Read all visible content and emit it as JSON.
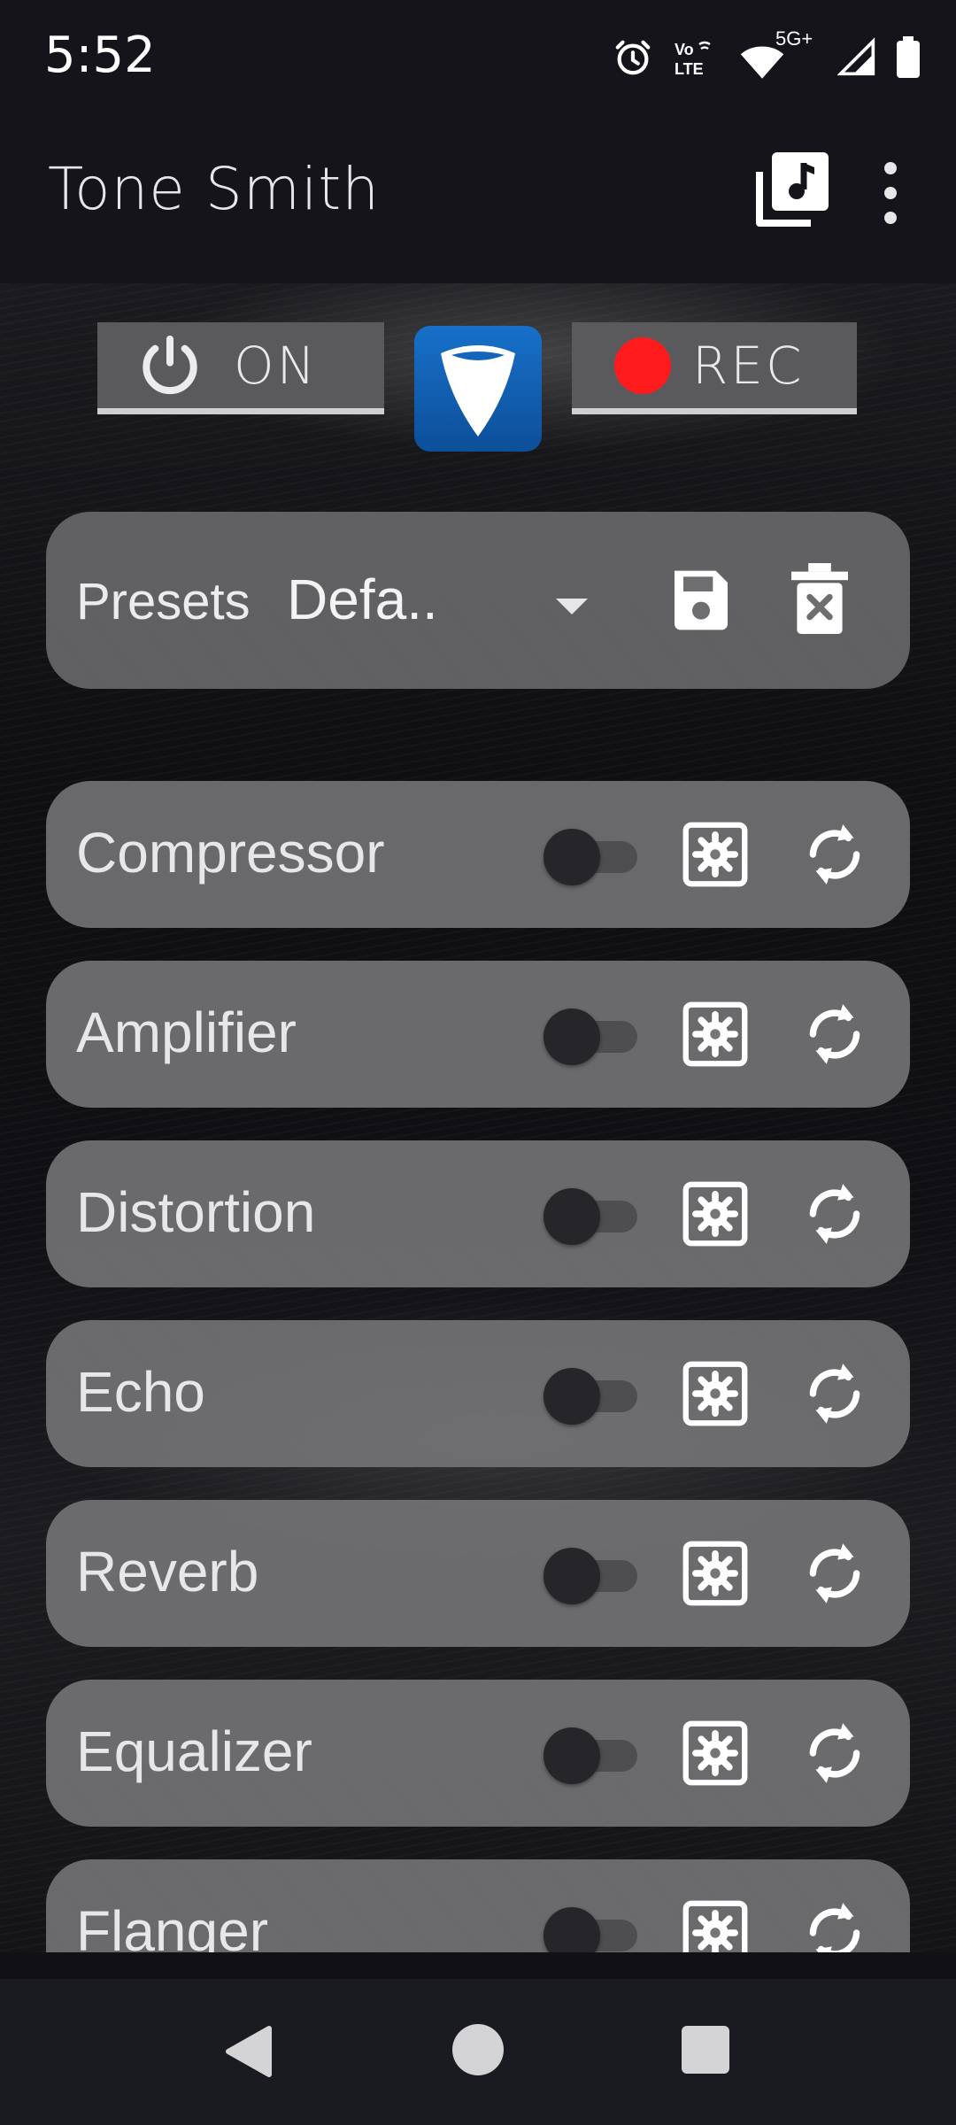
{
  "status_bar": {
    "time": "5:52",
    "network_label": "5G+",
    "volte_label": "Vo LTE",
    "icons": [
      "alarm-icon",
      "volte-icon",
      "wifi-icon",
      "signal-icon",
      "battery-icon"
    ]
  },
  "app_bar": {
    "title": "Tone Smith",
    "actions": [
      "music-library-icon",
      "more-vert-icon"
    ]
  },
  "controls": {
    "power_label": "ON",
    "rec_label": "REC",
    "rec_color": "#ff1b1b",
    "logo_color": "#1566bb"
  },
  "presets": {
    "label": "Presets",
    "selected": "Defa.."
  },
  "effects": [
    {
      "label": "Compressor",
      "enabled": false
    },
    {
      "label": "Amplifier",
      "enabled": false
    },
    {
      "label": "Distortion",
      "enabled": false
    },
    {
      "label": "Echo",
      "enabled": false
    },
    {
      "label": "Reverb",
      "enabled": false
    },
    {
      "label": "Equalizer",
      "enabled": false
    },
    {
      "label": "Flanger",
      "enabled": false
    }
  ],
  "nav": {
    "buttons": [
      "back-icon",
      "home-icon",
      "recents-icon"
    ]
  }
}
